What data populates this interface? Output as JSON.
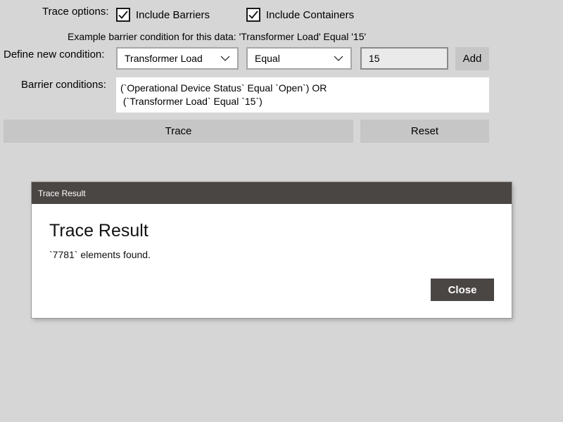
{
  "trace_options": {
    "label": "Trace options:",
    "include_barriers": {
      "label": "Include Barriers",
      "checked": true
    },
    "include_containers": {
      "label": "Include Containers",
      "checked": true
    }
  },
  "example_text": "Example barrier condition for this data: 'Transformer Load' Equal '15'",
  "define_condition": {
    "label": "Define new condition:",
    "attribute_value": "Transformer Load",
    "operator_value": "Equal",
    "value_input": "15",
    "add_label": "Add"
  },
  "barrier_conditions": {
    "label": "Barrier conditions:",
    "text": "(`Operational Device Status` Equal `Open`) OR\n (`Transformer Load` Equal `15`)"
  },
  "actions": {
    "trace_label": "Trace",
    "reset_label": "Reset"
  },
  "dialog": {
    "title": "Trace Result",
    "heading": "Trace Result",
    "message": "`7781` elements found.",
    "close_label": "Close"
  },
  "colors": {
    "background": "#d6d6d6",
    "button": "#c6c6c6",
    "dialog_title_bar": "#4a4644",
    "close_button": "#4a4644"
  }
}
